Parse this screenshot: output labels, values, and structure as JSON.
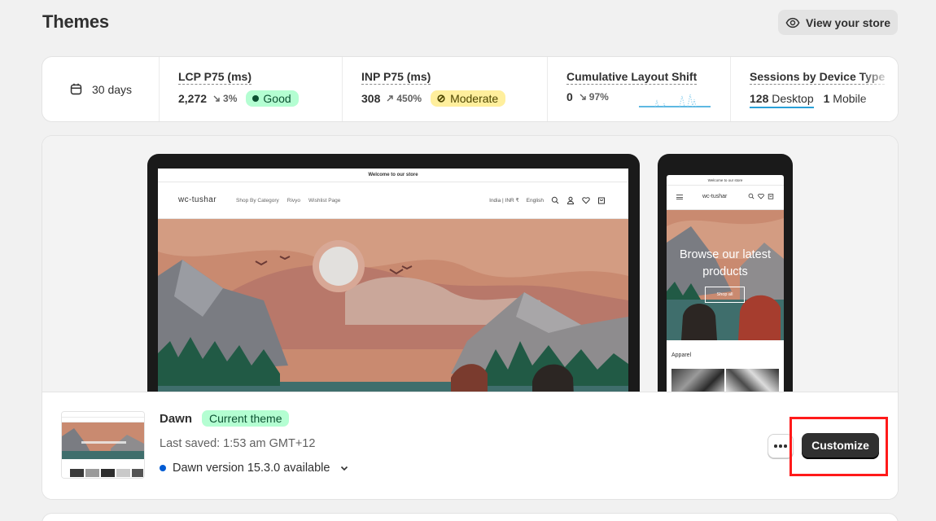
{
  "page": {
    "title": "Themes",
    "view_store_label": "View your store"
  },
  "metrics": {
    "range_label": "30 days",
    "lcp": {
      "label": "LCP P75 (ms)",
      "value": "2,272",
      "delta": "3%",
      "delta_direction": "down",
      "status": "Good"
    },
    "inp": {
      "label": "INP P75 (ms)",
      "value": "308",
      "delta": "450%",
      "delta_direction": "up",
      "status": "Moderate"
    },
    "cls": {
      "label": "Cumulative Layout Shift",
      "value": "0",
      "delta": "97%",
      "delta_direction": "down"
    },
    "sessions": {
      "label": "Sessions by Device Type",
      "items": [
        {
          "count": "128",
          "device": "Desktop"
        },
        {
          "count": "1",
          "device": "Mobile"
        }
      ]
    }
  },
  "preview": {
    "desktop": {
      "announcement": "Welcome to our store",
      "brand": "wc-tushar",
      "nav": [
        "Shop By Category",
        "Rivyo",
        "Wishlist Page"
      ],
      "locale": "India | INR ₹",
      "language": "English"
    },
    "mobile": {
      "announcement": "Welcome to our store",
      "brand": "wc-tushar",
      "hero_text": "Browse our latest products",
      "hero_button": "Shop all",
      "collection_title": "Apparel"
    }
  },
  "theme": {
    "name": "Dawn",
    "badge": "Current theme",
    "last_saved": "Last saved: 1:53 am GMT+12",
    "version_notice": "Dawn version 15.3.0 available",
    "customize_label": "Customize"
  },
  "colors": {
    "good_bg": "#b4fed2",
    "moderate_bg": "#ffef9d",
    "primary_button": "#303030",
    "highlight": "#ff1a1a",
    "info_dot": "#005bd3"
  }
}
